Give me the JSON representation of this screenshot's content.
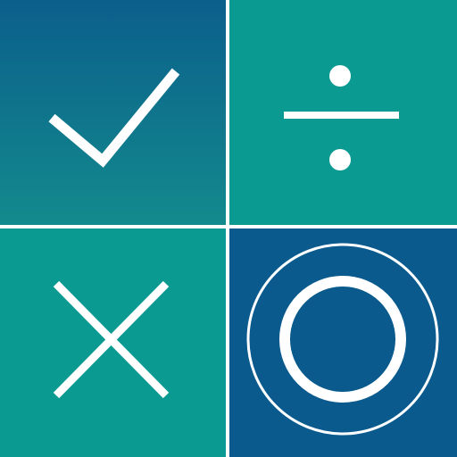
{
  "tiles": [
    {
      "id": "top-left",
      "icon": "checkmark-icon",
      "gradient": [
        "#0a5f8a",
        "#1a8a8c"
      ]
    },
    {
      "id": "top-right",
      "icon": "divide-icon",
      "gradient": [
        "#0b9a92",
        "#0b9a92"
      ]
    },
    {
      "id": "bottom-left",
      "icon": "cross-icon",
      "gradient": [
        "#0b9a92",
        "#0b9a92"
      ]
    },
    {
      "id": "bottom-right",
      "icon": "circle-icon",
      "gradient": [
        "#0a5a8e",
        "#0a5a8e"
      ]
    }
  ],
  "colors": {
    "divider": "#ffffff",
    "glyph": "#ffffff",
    "blue": "#0a5a8e",
    "teal": "#0b9a92"
  }
}
